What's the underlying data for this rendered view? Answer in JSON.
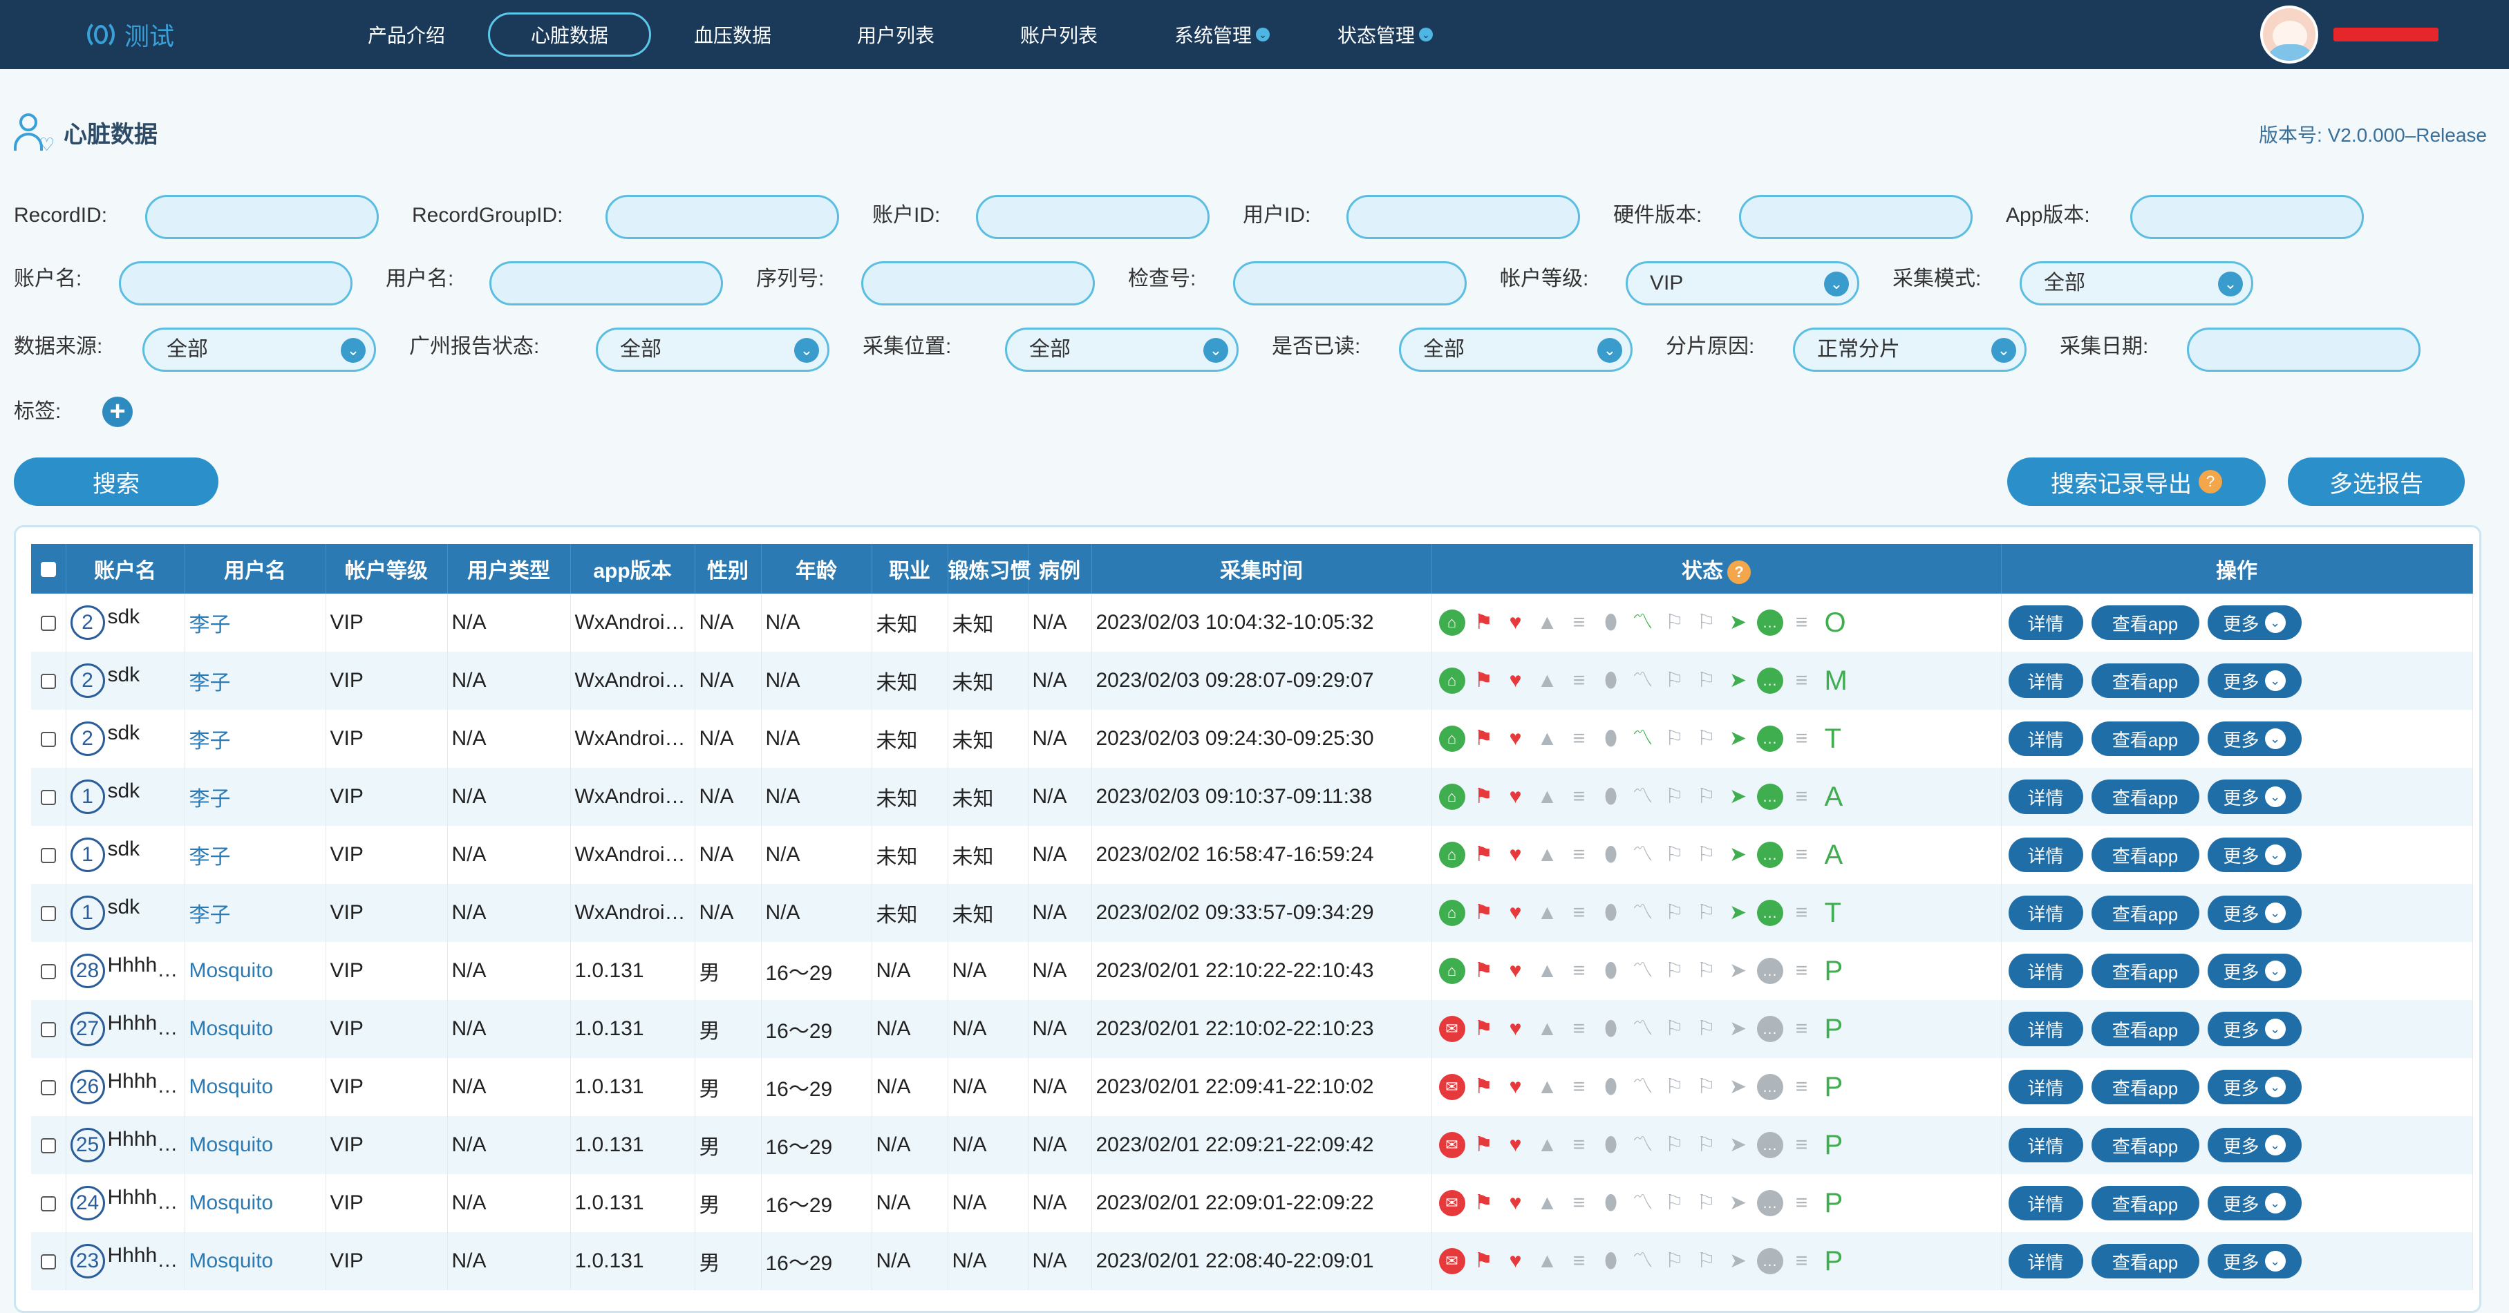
{
  "app": {
    "logo_text": "测试",
    "nav": [
      {
        "label": "产品介绍",
        "active": false,
        "has_dropdown": false
      },
      {
        "label": "心脏数据",
        "active": true,
        "has_dropdown": false
      },
      {
        "label": "血压数据",
        "active": false,
        "has_dropdown": false
      },
      {
        "label": "用户列表",
        "active": false,
        "has_dropdown": false
      },
      {
        "label": "账户列表",
        "active": false,
        "has_dropdown": false
      },
      {
        "label": "系统管理",
        "active": false,
        "has_dropdown": true
      },
      {
        "label": "状态管理",
        "active": false,
        "has_dropdown": true
      }
    ]
  },
  "page": {
    "title": "心脏数据",
    "version": "版本号: V2.0.000–Release"
  },
  "filters": {
    "record_id": {
      "label": "RecordID:",
      "value": ""
    },
    "record_group_id": {
      "label": "RecordGroupID:",
      "value": ""
    },
    "account_id": {
      "label": "账户ID:",
      "value": ""
    },
    "user_id": {
      "label": "用户ID:",
      "value": ""
    },
    "hw_version": {
      "label": "硬件版本:",
      "value": ""
    },
    "app_version": {
      "label": "App版本:",
      "value": ""
    },
    "account_name": {
      "label": "账户名:",
      "value": ""
    },
    "user_name": {
      "label": "用户名:",
      "value": ""
    },
    "serial": {
      "label": "序列号:",
      "value": ""
    },
    "check_no": {
      "label": "检查号:",
      "value": ""
    },
    "account_level": {
      "label": "帐户等级:",
      "value": "VIP"
    },
    "collect_mode": {
      "label": "采集模式:",
      "value": "全部"
    },
    "data_source": {
      "label": "数据来源:",
      "value": "全部"
    },
    "gz_report": {
      "label": "广州报告状态:",
      "value": "全部"
    },
    "collect_pos": {
      "label": "采集位置:",
      "value": "全部"
    },
    "is_read": {
      "label": "是否已读:",
      "value": "全部"
    },
    "split_reason": {
      "label": "分片原因:",
      "value": "正常分片"
    },
    "collect_date": {
      "label": "采集日期:",
      "value": ""
    },
    "tags": {
      "label": "标签:"
    }
  },
  "buttons": {
    "search": "搜索",
    "export": "搜索记录导出",
    "multi_report": "多选报告"
  },
  "table": {
    "headers": [
      "账户名",
      "用户名",
      "帐户等级",
      "用户类型",
      "app版本",
      "性别",
      "年龄",
      "职业",
      "锻炼习惯",
      "病例",
      "采集时间",
      "状态",
      "操作"
    ],
    "actions": {
      "detail": "详情",
      "view_app": "查看app",
      "more": "更多"
    },
    "rows": [
      {
        "num": "2",
        "account": "sdk",
        "user": "李子",
        "level": "VIP",
        "utype": "N/A",
        "app": "WxAndroid...",
        "sex": "N/A",
        "age": "N/A",
        "job": "未知",
        "habit": "未知",
        "case": "N/A",
        "time": "2023/02/03 10:04:32-10:05:32",
        "first_icon": "green",
        "ecg": "green",
        "chat": "green",
        "letter": "O"
      },
      {
        "num": "2",
        "account": "sdk",
        "user": "李子",
        "level": "VIP",
        "utype": "N/A",
        "app": "WxAndroid...",
        "sex": "N/A",
        "age": "N/A",
        "job": "未知",
        "habit": "未知",
        "case": "N/A",
        "time": "2023/02/03 09:28:07-09:29:07",
        "first_icon": "green",
        "ecg": "gray",
        "chat": "green",
        "letter": "M"
      },
      {
        "num": "2",
        "account": "sdk",
        "user": "李子",
        "level": "VIP",
        "utype": "N/A",
        "app": "WxAndroid...",
        "sex": "N/A",
        "age": "N/A",
        "job": "未知",
        "habit": "未知",
        "case": "N/A",
        "time": "2023/02/03 09:24:30-09:25:30",
        "first_icon": "green",
        "ecg": "green",
        "chat": "green",
        "letter": "T"
      },
      {
        "num": "1",
        "account": "sdk",
        "user": "李子",
        "level": "VIP",
        "utype": "N/A",
        "app": "WxAndroid...",
        "sex": "N/A",
        "age": "N/A",
        "job": "未知",
        "habit": "未知",
        "case": "N/A",
        "time": "2023/02/03 09:10:37-09:11:38",
        "first_icon": "green",
        "ecg": "gray",
        "chat": "green",
        "letter": "A"
      },
      {
        "num": "1",
        "account": "sdk",
        "user": "李子",
        "level": "VIP",
        "utype": "N/A",
        "app": "WxAndroid...",
        "sex": "N/A",
        "age": "N/A",
        "job": "未知",
        "habit": "未知",
        "case": "N/A",
        "time": "2023/02/02 16:58:47-16:59:24",
        "first_icon": "green",
        "ecg": "gray",
        "chat": "green",
        "letter": "A"
      },
      {
        "num": "1",
        "account": "sdk",
        "user": "李子",
        "level": "VIP",
        "utype": "N/A",
        "app": "WxAndroid...",
        "sex": "N/A",
        "age": "N/A",
        "job": "未知",
        "habit": "未知",
        "case": "N/A",
        "time": "2023/02/02 09:33:57-09:34:29",
        "first_icon": "green",
        "ecg": "gray",
        "chat": "green",
        "letter": "T"
      },
      {
        "num": "28",
        "account": "Hhhhhhhh",
        "user": "Mosquito",
        "level": "VIP",
        "utype": "N/A",
        "app": "1.0.131",
        "sex": "男",
        "age": "16～29",
        "job": "N/A",
        "habit": "N/A",
        "case": "N/A",
        "time": "2023/02/01 22:10:22-22:10:43",
        "first_icon": "green",
        "ecg": "gray",
        "chat": "gray",
        "letter": "P"
      },
      {
        "num": "27",
        "account": "Hhhhhhhh",
        "user": "Mosquito",
        "level": "VIP",
        "utype": "N/A",
        "app": "1.0.131",
        "sex": "男",
        "age": "16～29",
        "job": "N/A",
        "habit": "N/A",
        "case": "N/A",
        "time": "2023/02/01 22:10:02-22:10:23",
        "first_icon": "red",
        "ecg": "gray",
        "chat": "gray",
        "letter": "P"
      },
      {
        "num": "26",
        "account": "Hhhhhhhh",
        "user": "Mosquito",
        "level": "VIP",
        "utype": "N/A",
        "app": "1.0.131",
        "sex": "男",
        "age": "16～29",
        "job": "N/A",
        "habit": "N/A",
        "case": "N/A",
        "time": "2023/02/01 22:09:41-22:10:02",
        "first_icon": "red",
        "ecg": "gray",
        "chat": "gray",
        "letter": "P"
      },
      {
        "num": "25",
        "account": "Hhhhhhhh",
        "user": "Mosquito",
        "level": "VIP",
        "utype": "N/A",
        "app": "1.0.131",
        "sex": "男",
        "age": "16～29",
        "job": "N/A",
        "habit": "N/A",
        "case": "N/A",
        "time": "2023/02/01 22:09:21-22:09:42",
        "first_icon": "red",
        "ecg": "gray",
        "chat": "gray",
        "letter": "P"
      },
      {
        "num": "24",
        "account": "Hhhhhhhh",
        "user": "Mosquito",
        "level": "VIP",
        "utype": "N/A",
        "app": "1.0.131",
        "sex": "男",
        "age": "16～29",
        "job": "N/A",
        "habit": "N/A",
        "case": "N/A",
        "time": "2023/02/01 22:09:01-22:09:22",
        "first_icon": "red",
        "ecg": "gray",
        "chat": "gray",
        "letter": "P"
      },
      {
        "num": "23",
        "account": "Hhhhhhhh",
        "user": "Mosquito",
        "level": "VIP",
        "utype": "N/A",
        "app": "1.0.131",
        "sex": "男",
        "age": "16～29",
        "job": "N/A",
        "habit": "N/A",
        "case": "N/A",
        "time": "2023/02/01 22:08:40-22:09:01",
        "first_icon": "red",
        "ecg": "gray",
        "chat": "gray",
        "letter": "P"
      }
    ]
  }
}
